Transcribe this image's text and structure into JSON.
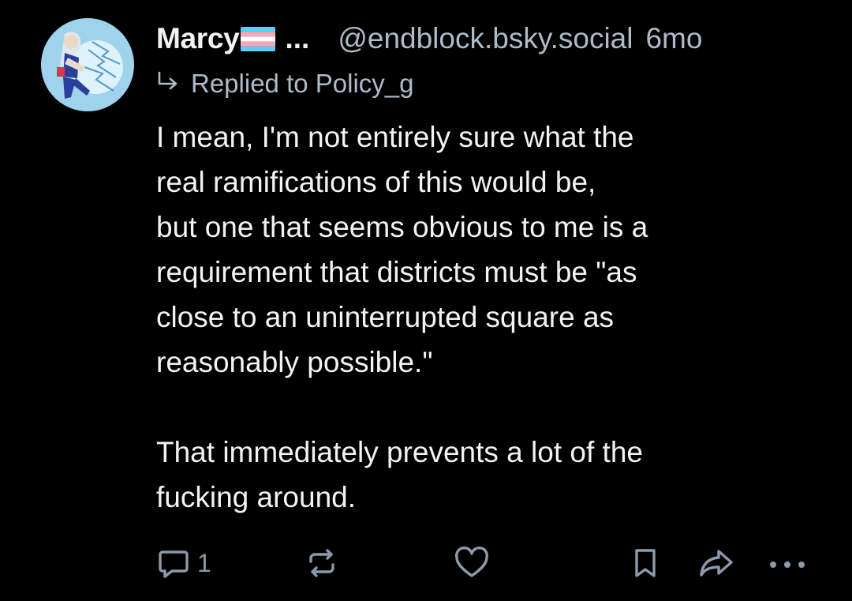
{
  "post": {
    "author": {
      "display_name": "Marcy",
      "name_suffix": "...",
      "handle": "@endblock.bsky.social",
      "flag_colors": [
        "#5bcefa",
        "#f5a9b8",
        "#ffffff",
        "#f5a9b8",
        "#5bcefa"
      ]
    },
    "time": "6mo",
    "reply_to": "Replied to Policy_g",
    "body_lines_1": [
      "I mean, I'm not entirely sure what the",
      "real ramifications of this would be,",
      "but one that seems obvious to me is a",
      "requirement that districts must be \"as",
      "close to an uninterrupted square as",
      "reasonably possible.\""
    ],
    "body_lines_2": [
      "That immediately prevents a lot of the",
      "fucking around."
    ],
    "actions": {
      "reply_icon": "speech-bubble-icon",
      "reply_count": "1",
      "repost_icon": "repost-arrows-icon",
      "like_icon": "heart-icon",
      "bookmark_icon": "bookmark-icon",
      "share_icon": "share-arrow-icon",
      "more_icon": "more-dots-icon"
    }
  },
  "colors": {
    "background": "#000000",
    "text": "#f1f3f5",
    "muted": "#aebbc9",
    "icon": "#8c9aab"
  }
}
